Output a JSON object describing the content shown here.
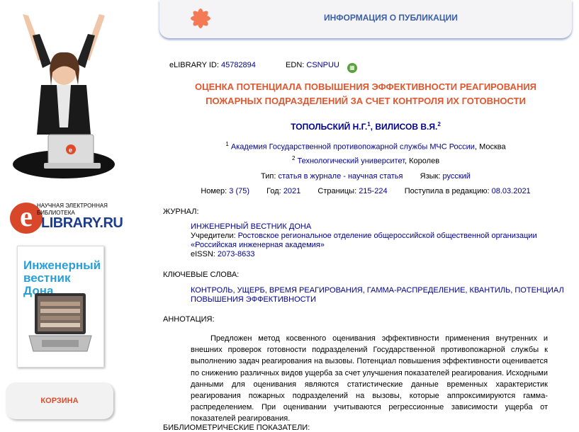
{
  "header": {
    "title": "ИНФОРМАЦИЯ О ПУБЛИКАЦИИ"
  },
  "sidebar": {
    "logo_small": "НАУЧНАЯ ЭЛЕКТРОННАЯ БИБЛИОТЕКА",
    "logo_big": "LIBRARY.RU",
    "logo_letter": "e",
    "cover_title": "Инженерный вестник Дона",
    "cart_label": "КОРЗИНА"
  },
  "publication": {
    "elibrary_id_label": "eLIBRARY ID:",
    "elibrary_id": "45782894",
    "edn_label": "EDN:",
    "edn": "CSNPUU",
    "title_line1": "ОЦЕНКА ПОТЕНЦИАЛА ПОВЫШЕНИЯ ЭФФЕКТИВНОСТИ РЕАГИРОВАНИЯ",
    "title_line2": "ПОЖАРНЫХ ПОДРАЗДЕЛЕНИЙ ЗА СЧЕТ КОНТРОЛЯ ИХ ГОТОВНОСТИ",
    "author1": "ТОПОЛЬСКИЙ Н.Г.",
    "author1_sup": "1",
    "author2": "ВИЛИСОВ В.Я.",
    "author2_sup": "2",
    "aff1_sup": "1",
    "aff1_name": "Академия Государственной противопожарной службы МЧС России",
    "aff1_city": ", Москва",
    "aff2_sup": "2",
    "aff2_name": "Технологический университет",
    "aff2_city": ", Королев",
    "type_label": "Тип:",
    "type_value": "статья в журнале - научная статья",
    "lang_label": "Язык:",
    "lang_value": "русский",
    "number_label": "Номер:",
    "number_value": "3 (75)",
    "year_label": "Год:",
    "year_value": "2021",
    "pages_label": "Страницы:",
    "pages_value": "215-224",
    "received_label": "Поступила в редакцию:",
    "received_value": "08.03.2021"
  },
  "journal": {
    "label": "ЖУРНАЛ:",
    "name": "ИНЖЕНЕРНЫЙ ВЕСТНИК ДОНА",
    "founder_label": "Учредители:",
    "founder_line1": "Ростовское региональное отделение общероссийской общественной организации",
    "founder_line2": "«Российская инженерная академия»",
    "eissn_label": "eISSN:",
    "eissn": "2073-8633"
  },
  "keywords": {
    "label": "КЛЮЧЕВЫЕ СЛОВА:",
    "line1": "КОНТРОЛЬ, УЩЕРБ, ВРЕМЯ РЕАГИРОВАНИЯ, ГАММА-РАСПРЕДЕЛЕНИЕ, КВАНТИЛЬ, ПОТЕНЦИАЛ",
    "line2": "ПОВЫШЕНИЯ ЭФФЕКТИВНОСТИ"
  },
  "abstract": {
    "label": "АННОТАЦИЯ:",
    "text": "Предложен метод косвенного оценивания эффективности применения внутренних и внешних проверок готовности подразделений Государственной противопожарной службы к выполнению задач реагирования на вызовы. Потенциал повышения эффективности оценивается по снижению различных видов ущерба за счет улучшения показателей реагирования. Исходными данными для оценивания являются статистические данные временных характеристик реагирования пожарных подразделений на вызовы, которые аппроксимируются гамма-распределением. При оценивании учитываются регрессионные зависимости ущерба от показателей реагирования."
  },
  "next_section": {
    "label": "БИБЛИОМЕТРИЧЕСКИЕ ПОКАЗАТЕЛИ:"
  },
  "colors": {
    "accent": "#e0562f",
    "link": "#00008f",
    "header": "#3b5ea8"
  }
}
